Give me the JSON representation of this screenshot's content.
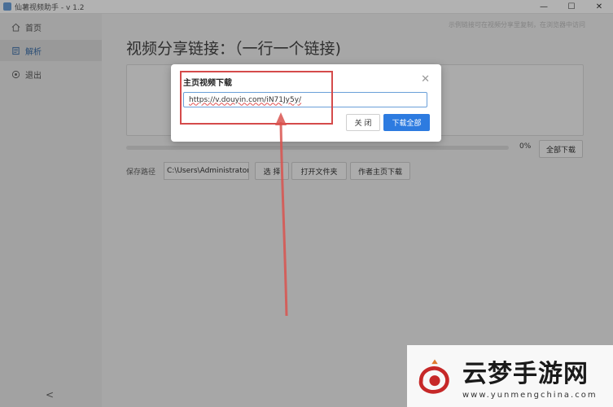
{
  "window": {
    "title": "仙薯视频助手 - v 1.2",
    "minimize": "—",
    "maximize": "☐",
    "close": "✕"
  },
  "sidebar": {
    "items": [
      {
        "label": "首页",
        "icon": "home-icon"
      },
      {
        "label": "解析",
        "icon": "document-icon",
        "active": true
      },
      {
        "label": "退出",
        "icon": "exit-icon"
      }
    ],
    "collapse": "<"
  },
  "main": {
    "hint": "示例链接可在视频分享里复制，在浏览器中访问",
    "heading": "视频分享链接：（一行一个链接)",
    "progress": {
      "value_percent": 0,
      "label": "0%"
    },
    "download_all": "全部下载",
    "save_path_label": "保存路径",
    "save_path_value": "C:\\Users\\Administrator\\",
    "choose": "选 择",
    "open_folder": "打开文件夹",
    "author_download": "作者主页下载"
  },
  "modal": {
    "title": "主页视频下载",
    "close_x": "✕",
    "input_value": "https://v.douyin.com/iN71Jy5y/",
    "close_button": "关 闭",
    "download_button": "下载全部"
  },
  "watermark": {
    "text_cn": "云梦手游网",
    "url": "www.yunmengchina.com"
  },
  "colors": {
    "accent": "#2d7be0",
    "annotation": "#d54b4b"
  }
}
